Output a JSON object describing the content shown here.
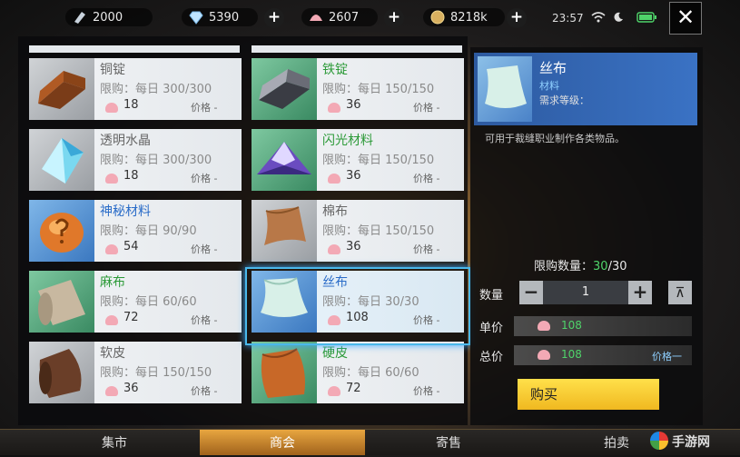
{
  "topbar": {
    "gold": "2000",
    "diamonds": "5390",
    "shells": "2607",
    "coins": "8218k",
    "time": "23:57",
    "add_symbol": "+",
    "close_symbol": "✕"
  },
  "items": [
    {
      "name": "铜锭",
      "limit": "限购：每日 300/300",
      "cost": "18",
      "price": "价格 -",
      "color": "gray"
    },
    {
      "name": "铁锭",
      "limit": "限购：每日 150/150",
      "cost": "36",
      "price": "价格 -",
      "color": "green"
    },
    {
      "name": "透明水晶",
      "limit": "限购：每日 300/300",
      "cost": "18",
      "price": "价格 -",
      "color": "gray"
    },
    {
      "name": "闪光材料",
      "limit": "限购：每日 150/150",
      "cost": "36",
      "price": "价格 -",
      "color": "green"
    },
    {
      "name": "神秘材料",
      "limit": "限购：每日 90/90",
      "cost": "54",
      "price": "价格 -",
      "color": "blue"
    },
    {
      "name": "棉布",
      "limit": "限购：每日 150/150",
      "cost": "36",
      "price": "价格 -",
      "color": "gray"
    },
    {
      "name": "麻布",
      "limit": "限购：每日 60/60",
      "cost": "72",
      "price": "价格 -",
      "color": "green"
    },
    {
      "name": "丝布",
      "limit": "限购：每日 30/30",
      "cost": "108",
      "price": "价格 -",
      "color": "blue"
    },
    {
      "name": "软皮",
      "limit": "限购：每日 150/150",
      "cost": "36",
      "price": "价格 -",
      "color": "gray"
    },
    {
      "name": "硬皮",
      "limit": "限购：每日 60/60",
      "cost": "72",
      "price": "价格 -",
      "color": "green"
    }
  ],
  "detail": {
    "name": "丝布",
    "type": "材料",
    "requirement": "需求等级：",
    "description": "可用于裁缝职业制作各类物品。",
    "limit_label": "限购数量：",
    "limit_current": "30",
    "limit_total": "/30",
    "qty_label": "数量",
    "quantity": "1",
    "minus": "−",
    "plus": "+",
    "max_symbol": "⊼",
    "unit_label": "单价",
    "unit_price": "108",
    "total_label": "总价",
    "total_price": "108",
    "total_price_text": "价格一",
    "buy_label": "购买"
  },
  "tabs": {
    "market": "集市",
    "guild_shop": "商会",
    "consignment": "寄售",
    "auction": "拍卖"
  },
  "watermark": "手游网",
  "colors": {
    "accent": "#e8a640",
    "selection": "#4ab8ea",
    "green_text": "#4fd36a",
    "buy_button": "#f5c52c"
  }
}
